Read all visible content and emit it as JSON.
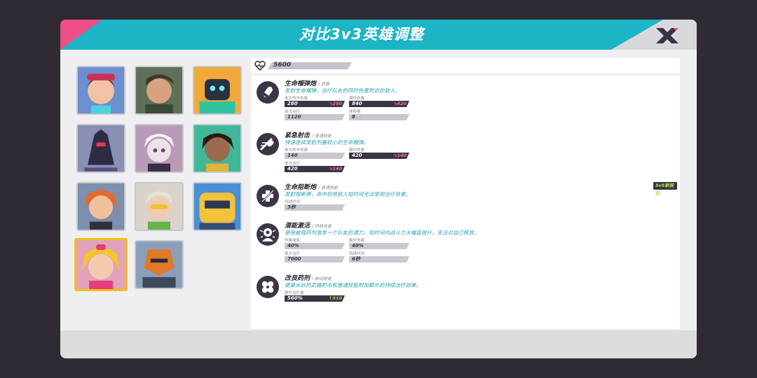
{
  "header": {
    "title": "对比3v3英雄调整"
  },
  "hp": {
    "value": "5600"
  },
  "heroes": [
    "hero-1",
    "hero-2",
    "hero-3",
    "hero-4",
    "hero-5",
    "hero-6",
    "hero-7",
    "hero-8",
    "hero-9",
    "hero-10",
    "hero-11"
  ],
  "selected_hero": "hero-10",
  "skills": [
    {
      "name": "生命榴弹炮",
      "type": "/ 武器",
      "desc": "发射生命榴弹，治疗队友的同时伤害附近的敌人。",
      "stats": [
        {
          "label": "单次命中伤害",
          "value": "280",
          "delta": "↘280",
          "dark": true
        },
        {
          "label": "爆炸伤害",
          "value": "840",
          "delta": "↘420",
          "dark": true
        },
        {
          "label": "单次治疗",
          "value": "1120",
          "delta": "",
          "dark": false
        },
        {
          "label": "弹容量",
          "value": "8",
          "delta": "",
          "dark": false
        }
      ]
    },
    {
      "name": "紧急射击",
      "type": "/ 普通技能",
      "desc": "快速连续发射剂量较小的生命榴弹。",
      "stats": [
        {
          "label": "单次命中伤害",
          "value": "140",
          "delta": "",
          "dark": false
        },
        {
          "label": "爆炸伤害",
          "value": "420",
          "delta": "↘140",
          "dark": true
        },
        {
          "label": "单次治疗",
          "value": "420",
          "delta": "↘140",
          "dark": true
        }
      ]
    },
    {
      "name": "生命阻断炮",
      "type": "/ 普通技能",
      "desc": "发射阻断弹，命中后将敌人短时间无法受到治疗效果。",
      "badge": "5v5新技能",
      "stats": [
        {
          "label": "持续时间",
          "value": "3秒",
          "delta": "",
          "dark": false
        }
      ]
    },
    {
      "name": "潜能激活",
      "type": "/ 终极技能",
      "desc": "使用被弱药剂激发一个队友的潜力，短时间内战斗力大幅度提升，无法对自己释放。",
      "stats": [
        {
          "label": "伤害减免",
          "value": "40%",
          "delta": "",
          "dark": false
        },
        {
          "label": "额外伤害",
          "value": "40%",
          "delta": "",
          "dark": false
        },
        {
          "label": "单次治疗",
          "value": "7000",
          "delta": "",
          "dark": false
        },
        {
          "label": "持续时间",
          "value": "6秒",
          "delta": "",
          "dark": false
        }
      ]
    },
    {
      "name": "改良药剂",
      "type": "/ 被动技能",
      "desc": "使第米丝的武器射击和普通技能附加额外的持续治疗效果。",
      "stats": [
        {
          "label": "额外治疗量",
          "value": "560%",
          "delta": "↑510",
          "dark": true,
          "up": true
        }
      ]
    }
  ],
  "colors": {
    "accent": "#1bb5c6",
    "pink": "#ef4f88",
    "selected": "#f4c20d",
    "dark": "#3a3545"
  }
}
